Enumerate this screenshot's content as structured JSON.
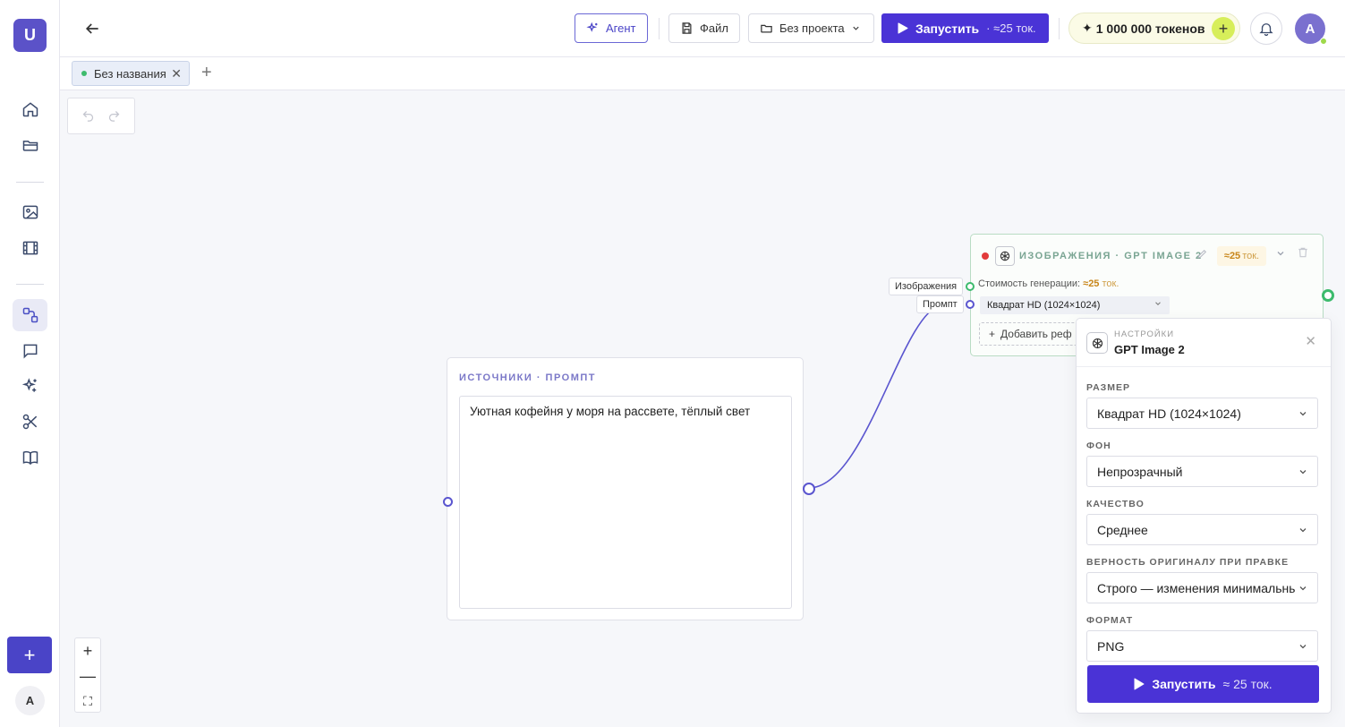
{
  "sidebar": {
    "logo_letter": "U",
    "user_initial": "A",
    "add_label": "+",
    "items": [
      {
        "icon": "home-icon"
      },
      {
        "icon": "folder-icon"
      },
      {
        "icon": "image-icon"
      },
      {
        "icon": "film-icon"
      },
      {
        "icon": "workflow-icon",
        "active": true
      },
      {
        "icon": "chat-icon"
      },
      {
        "icon": "sparkles-icon"
      },
      {
        "icon": "scissors-icon"
      },
      {
        "icon": "book-icon"
      }
    ]
  },
  "topbar": {
    "agent_label": "Агент",
    "file_label": "Файл",
    "project_label": "Без проекта",
    "run_label": "Запустить",
    "run_cost": "· ≈25 ток.",
    "tokens_label": "1 000 000 токенов",
    "tokens_plus": "+",
    "avatar_initial": "A"
  },
  "tabs": {
    "active_tab": "Без названия",
    "close": "✕",
    "add": "+"
  },
  "canvas": {
    "zoom_in": "+",
    "zoom_out": "—",
    "fit": "⛶"
  },
  "prompt_node": {
    "header": "ИСТОЧНИКИ · ПРОМПТ",
    "text": "Уютная кофейня у моря на рассвете, тёплый свет"
  },
  "image_node": {
    "title": "ИЗОБРАЖЕНИЯ · GPT IMAGE 2",
    "cost_pill_value": "≈25",
    "cost_pill_unit": "ток.",
    "cost_line_label": "Стоимость генерации:",
    "cost_line_value": "≈25",
    "cost_line_unit": "ток.",
    "size_value": "Квадрат HD (1024×1024)",
    "add_ref_label": "Добавить реф",
    "port_images": "Изображения",
    "port_prompt": "Промпт"
  },
  "settings": {
    "subtitle": "НАСТРОЙКИ",
    "model": "GPT Image 2",
    "close": "✕",
    "fields": [
      {
        "label": "РАЗМЕР",
        "value": "Квадрат HD (1024×1024)"
      },
      {
        "label": "ФОН",
        "value": "Непрозрачный"
      },
      {
        "label": "КАЧЕСТВО",
        "value": "Среднее"
      },
      {
        "label": "ВЕРНОСТЬ ОРИГИНАЛУ ПРИ ПРАВКЕ",
        "value": "Строго — изменения минимальны"
      },
      {
        "label": "ФОРМАТ",
        "value": "PNG"
      }
    ],
    "run_label": "Запустить",
    "run_cost": "≈ 25 ток."
  },
  "colors": {
    "accent": "#4a33d6",
    "edge": "#5a55cf",
    "ok": "#3dbb6d",
    "warn": "#c8861a"
  }
}
